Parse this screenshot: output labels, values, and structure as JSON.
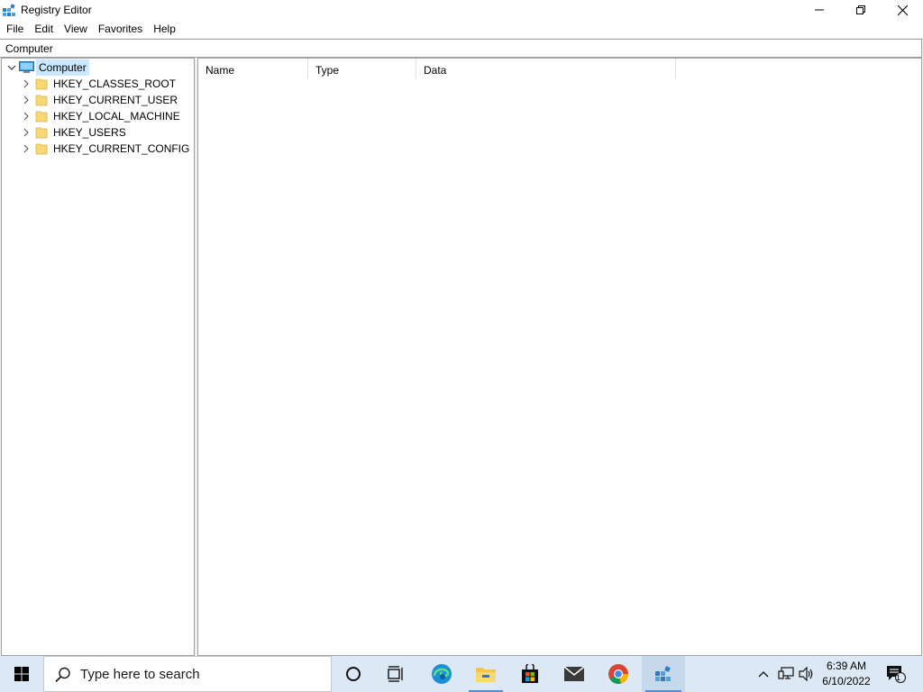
{
  "window": {
    "title": "Registry Editor",
    "controls": {
      "minimize": "minimize-icon",
      "maximize": "restore-icon",
      "close": "close-icon"
    }
  },
  "menu": [
    "File",
    "Edit",
    "View",
    "Favorites",
    "Help"
  ],
  "address": {
    "value": "Computer"
  },
  "tree": {
    "root": {
      "label": "Computer",
      "expanded": true,
      "selected": true,
      "icon": "computer-icon"
    },
    "keys": [
      {
        "label": "HKEY_CLASSES_ROOT",
        "icon": "folder-icon"
      },
      {
        "label": "HKEY_CURRENT_USER",
        "icon": "folder-icon"
      },
      {
        "label": "HKEY_LOCAL_MACHINE",
        "icon": "folder-icon"
      },
      {
        "label": "HKEY_USERS",
        "icon": "folder-icon"
      },
      {
        "label": "HKEY_CURRENT_CONFIG",
        "icon": "folder-icon"
      }
    ]
  },
  "list": {
    "columns": [
      "Name",
      "Type",
      "Data"
    ],
    "rows": []
  },
  "taskbar": {
    "search_placeholder": "Type here to search",
    "apps": [
      {
        "name": "cortana",
        "icon": "circle-icon"
      },
      {
        "name": "task-view",
        "icon": "task-view-icon"
      },
      {
        "name": "edge",
        "icon": "edge-icon"
      },
      {
        "name": "file-explorer",
        "icon": "folder-icon",
        "running": true
      },
      {
        "name": "store",
        "icon": "store-icon"
      },
      {
        "name": "mail",
        "icon": "mail-icon"
      },
      {
        "name": "chrome",
        "icon": "chrome-icon"
      },
      {
        "name": "registry-editor",
        "icon": "regedit-icon",
        "active": true
      }
    ],
    "clock": {
      "time": "6:39 AM",
      "date": "6/10/2022"
    },
    "notifications_count": "1"
  },
  "colors": {
    "selection": "#cce8ff",
    "taskbar": "#dce8f3",
    "accent": "#4a90d9",
    "folder": "#f8d775"
  }
}
